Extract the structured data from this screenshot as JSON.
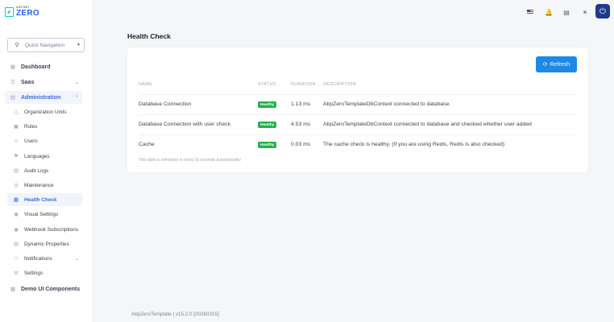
{
  "brand": {
    "small": "ASP.NET",
    "big": "ZERO"
  },
  "quick_nav": {
    "placeholder": "Quick Navigation"
  },
  "menu": {
    "dashboard": "Dashboard",
    "saas": "Saas",
    "administration": "Administration",
    "organization_units": "Organization Units",
    "roles": "Roles",
    "users": "Users",
    "languages": "Languages",
    "audit_logs": "Audit Logs",
    "maintenance": "Maintenance",
    "health_check": "Health Check",
    "visual_settings": "Visual Settings",
    "webhook_subscriptions": "Webhook Subscriptions",
    "dynamic_properties": "Dynamic Properties",
    "notifications": "Notifications",
    "settings": "Settings",
    "demo_ui": "Demo UI Components"
  },
  "page": {
    "title": "Health Check",
    "refresh_label": "Refresh",
    "columns": [
      "NAME",
      "STATUS",
      "DURATION",
      "DESCRIPTION"
    ],
    "rows": [
      {
        "name": "Database Connection",
        "status": "Healthy",
        "duration": "1.13 ms",
        "description": "AbpZeroTemplateDbContext connected to database."
      },
      {
        "name": "Database Connection with user check",
        "status": "Healthy",
        "duration": "4.53 ms",
        "description": "AbpZeroTemplateDbContext connected to database and checked whether user added"
      },
      {
        "name": "Cache",
        "status": "Healthy",
        "duration": "0.03 ms",
        "description": "The cache check is healthy. (If you are using Redis, Redis is also checked)"
      }
    ],
    "footnote": "This table is refreshed in every 10 seconds automatically!"
  },
  "footer": "AbpZeroTemplate | v15.2.0 [20260315]",
  "colors": {
    "accent": "#1e88e5",
    "healthy": "#22b14c",
    "active_bg": "#f1f4fb",
    "active_text": "#3b6bd8"
  },
  "icons": [
    "language-flag-icon",
    "bell-icon",
    "chat-icon",
    "sun-icon",
    "power-icon",
    "search-icon",
    "refresh-icon"
  ]
}
